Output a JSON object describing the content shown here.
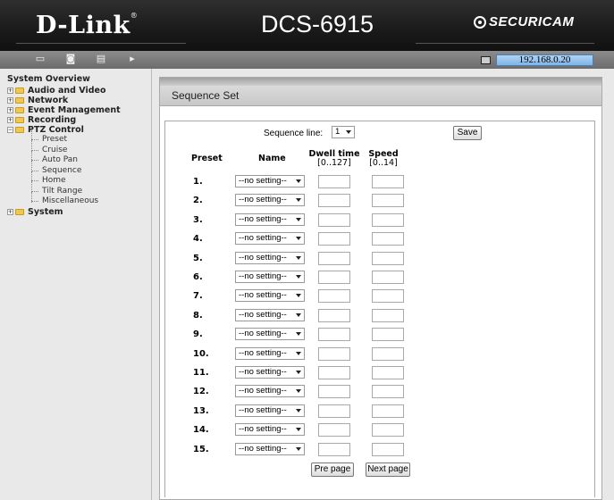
{
  "header": {
    "logo": "D-Link",
    "logo_mark": "®",
    "model": "DCS-6915",
    "brand": "SECURICAM"
  },
  "toolbar": {
    "icons": [
      "camera-icon",
      "snapshot-icon",
      "favorite-icon",
      "pan-icon"
    ],
    "ip_address": "192.168.0.20"
  },
  "sidebar": {
    "title": "System Overview",
    "items": [
      {
        "label": "Audio and Video",
        "expanded": false
      },
      {
        "label": "Network",
        "expanded": false
      },
      {
        "label": "Event Management",
        "expanded": false
      },
      {
        "label": "Recording",
        "expanded": false
      },
      {
        "label": "PTZ Control",
        "expanded": true
      },
      {
        "label": "System",
        "expanded": false
      }
    ],
    "ptz_sub": [
      "Preset",
      "Cruise",
      "Auto Pan",
      "Sequence",
      "Home",
      "Tilt Range",
      "Miscellaneous"
    ]
  },
  "section": {
    "title": "Sequence Set"
  },
  "form": {
    "sequence_line_label": "Sequence line:",
    "sequence_line_value": "1",
    "save_label": "Save",
    "col_preset": "Preset",
    "col_name": "Name",
    "col_dwell": "Dwell time",
    "col_dwell_range": "[0..127]",
    "col_speed": "Speed",
    "col_speed_range": "[0..14]",
    "rows": [
      {
        "num": "1.",
        "name": "--no setting--"
      },
      {
        "num": "2.",
        "name": "--no setting--"
      },
      {
        "num": "3.",
        "name": "--no setting--"
      },
      {
        "num": "4.",
        "name": "--no setting--"
      },
      {
        "num": "5.",
        "name": "--no setting--"
      },
      {
        "num": "6.",
        "name": "--no setting--"
      },
      {
        "num": "7.",
        "name": "--no setting--"
      },
      {
        "num": "8.",
        "name": "--no setting--"
      },
      {
        "num": "9.",
        "name": "--no setting--"
      },
      {
        "num": "10.",
        "name": "--no setting--"
      },
      {
        "num": "11.",
        "name": "--no setting--"
      },
      {
        "num": "12.",
        "name": "--no setting--"
      },
      {
        "num": "13.",
        "name": "--no setting--"
      },
      {
        "num": "14.",
        "name": "--no setting--"
      },
      {
        "num": "15.",
        "name": "--no setting--"
      }
    ],
    "pre_page_label": "Pre page",
    "next_page_label": "Next page"
  }
}
